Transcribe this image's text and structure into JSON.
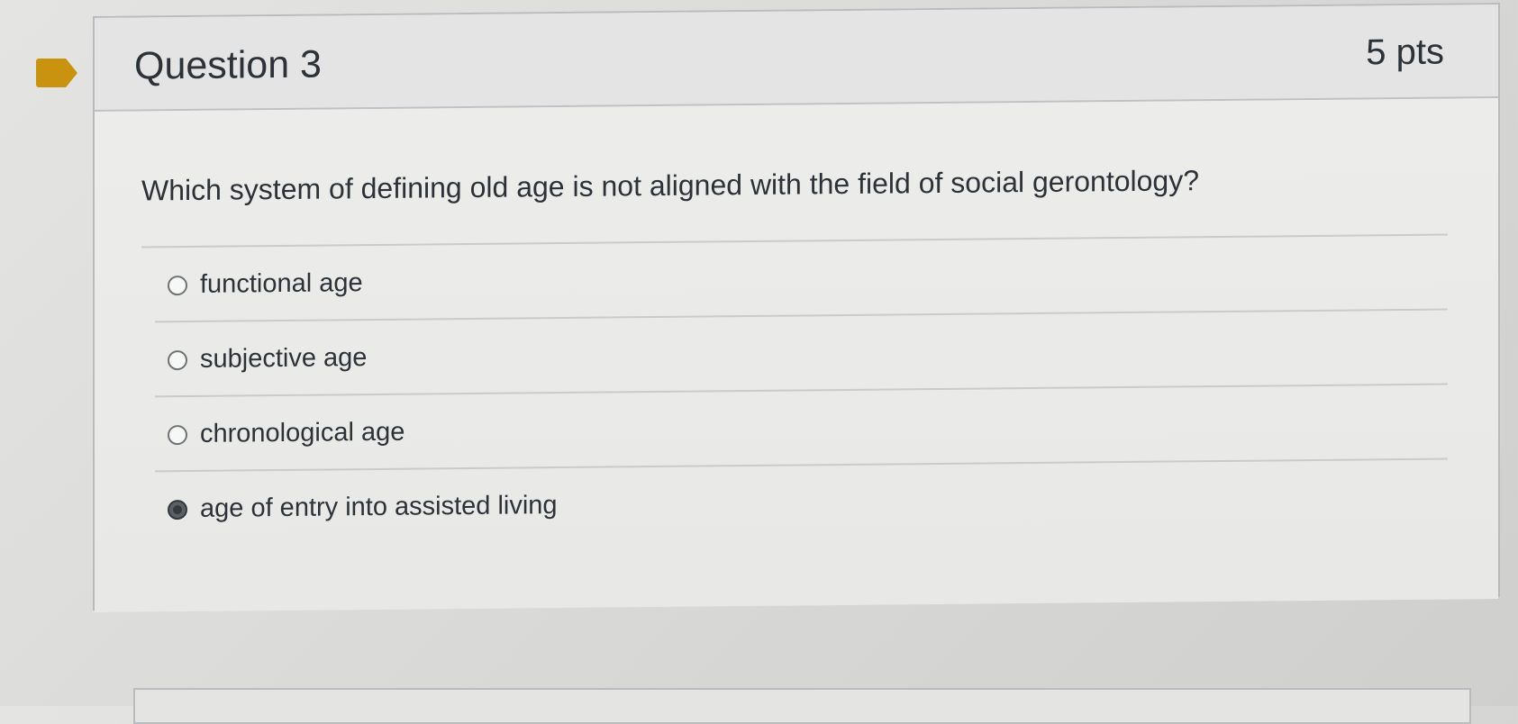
{
  "question": {
    "title": "Question 3",
    "points": "5 pts",
    "text": "Which system of defining old age is not aligned with the field of social gerontology?"
  },
  "answers": [
    {
      "label": "functional age",
      "selected": false
    },
    {
      "label": "subjective age",
      "selected": false
    },
    {
      "label": "chronological age",
      "selected": false
    },
    {
      "label": "age of entry into assisted living",
      "selected": true
    }
  ],
  "colors": {
    "flag": "#c9920f",
    "text": "#2c3238",
    "border": "#b9bcbf"
  },
  "icons": {
    "bookmark": "bookmark-flag-icon"
  }
}
